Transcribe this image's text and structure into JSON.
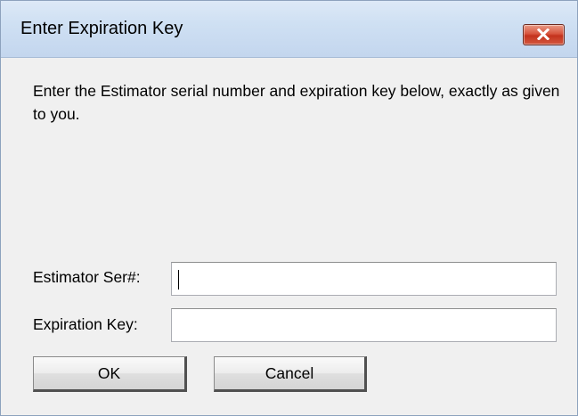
{
  "window": {
    "title": "Enter Expiration Key"
  },
  "dialog": {
    "instructions": "Enter the Estimator serial number and expiration key below, exactly as given to you.",
    "serial": {
      "label": "Estimator Ser#:",
      "value": ""
    },
    "key": {
      "label": "Expiration Key:",
      "value": ""
    },
    "ok_label": "OK",
    "cancel_label": "Cancel"
  },
  "icons": {
    "close": "close-icon"
  },
  "colors": {
    "close_button": "#d8553e",
    "titlebar": "#cfe0f3",
    "dialog_background": "#f0f0f0"
  }
}
